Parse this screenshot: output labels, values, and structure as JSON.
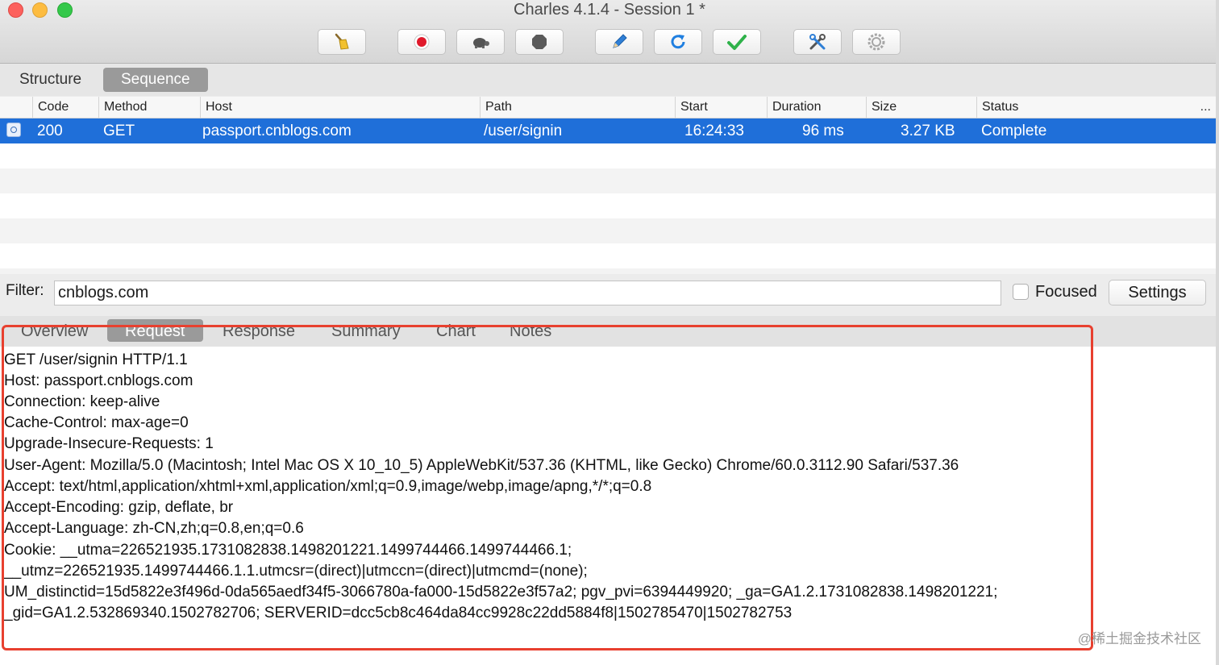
{
  "window": {
    "title": "Charles 4.1.4 - Session 1 *"
  },
  "toolbar": {
    "buttons": [
      {
        "icon": "broom-icon"
      },
      {
        "icon": "record-icon"
      },
      {
        "icon": "turtle-icon"
      },
      {
        "icon": "stop-hexagon-icon"
      },
      {
        "icon": "pen-icon"
      },
      {
        "icon": "refresh-icon"
      },
      {
        "icon": "checkmark-icon"
      },
      {
        "icon": "tools-icon"
      },
      {
        "icon": "gear-icon"
      }
    ]
  },
  "view_tabs": {
    "structure": "Structure",
    "sequence": "Sequence"
  },
  "table": {
    "columns": {
      "code": "Code",
      "method": "Method",
      "host": "Host",
      "path": "Path",
      "start": "Start",
      "duration": "Duration",
      "size": "Size",
      "status": "Status",
      "more": "..."
    },
    "rows": [
      {
        "code": "200",
        "method": "GET",
        "host": "passport.cnblogs.com",
        "path": "/user/signin",
        "start": "16:24:33",
        "duration": "96 ms",
        "size": "3.27 KB",
        "status": "Complete"
      }
    ]
  },
  "filter": {
    "label": "Filter:",
    "value": "cnblogs.com",
    "focused_label": "Focused",
    "focused_checked": false,
    "settings_label": "Settings"
  },
  "detail_tabs": {
    "overview": "Overview",
    "request": "Request",
    "response": "Response",
    "summary": "Summary",
    "chart": "Chart",
    "notes": "Notes"
  },
  "request_lines": [
    "GET /user/signin HTTP/1.1",
    "Host: passport.cnblogs.com",
    "Connection: keep-alive",
    "Cache-Control: max-age=0",
    "Upgrade-Insecure-Requests: 1",
    "User-Agent: Mozilla/5.0 (Macintosh; Intel Mac OS X 10_10_5) AppleWebKit/537.36 (KHTML, like Gecko) Chrome/60.0.3112.90 Safari/537.36",
    "Accept: text/html,application/xhtml+xml,application/xml;q=0.9,image/webp,image/apng,*/*;q=0.8",
    "Accept-Encoding: gzip, deflate, br",
    "Accept-Language: zh-CN,zh;q=0.8,en;q=0.6",
    "Cookie: __utma=226521935.1731082838.1498201221.1499744466.1499744466.1;",
    "__utmz=226521935.1499744466.1.1.utmcsr=(direct)|utmccn=(direct)|utmcmd=(none);",
    "UM_distinctid=15d5822e3f496d-0da565aedf34f5-3066780a-fa000-15d5822e3f57a2; pgv_pvi=6394449920; _ga=GA1.2.1731082838.1498201221;",
    "_gid=GA1.2.532869340.1502782706; SERVERID=dcc5cb8c464da84cc9928c22dd5884f8|1502785470|1502782753"
  ],
  "watermark": "@稀土掘金技术社区",
  "colors": {
    "selection": "#1f6fd9",
    "highlight_border": "#e8402f"
  }
}
